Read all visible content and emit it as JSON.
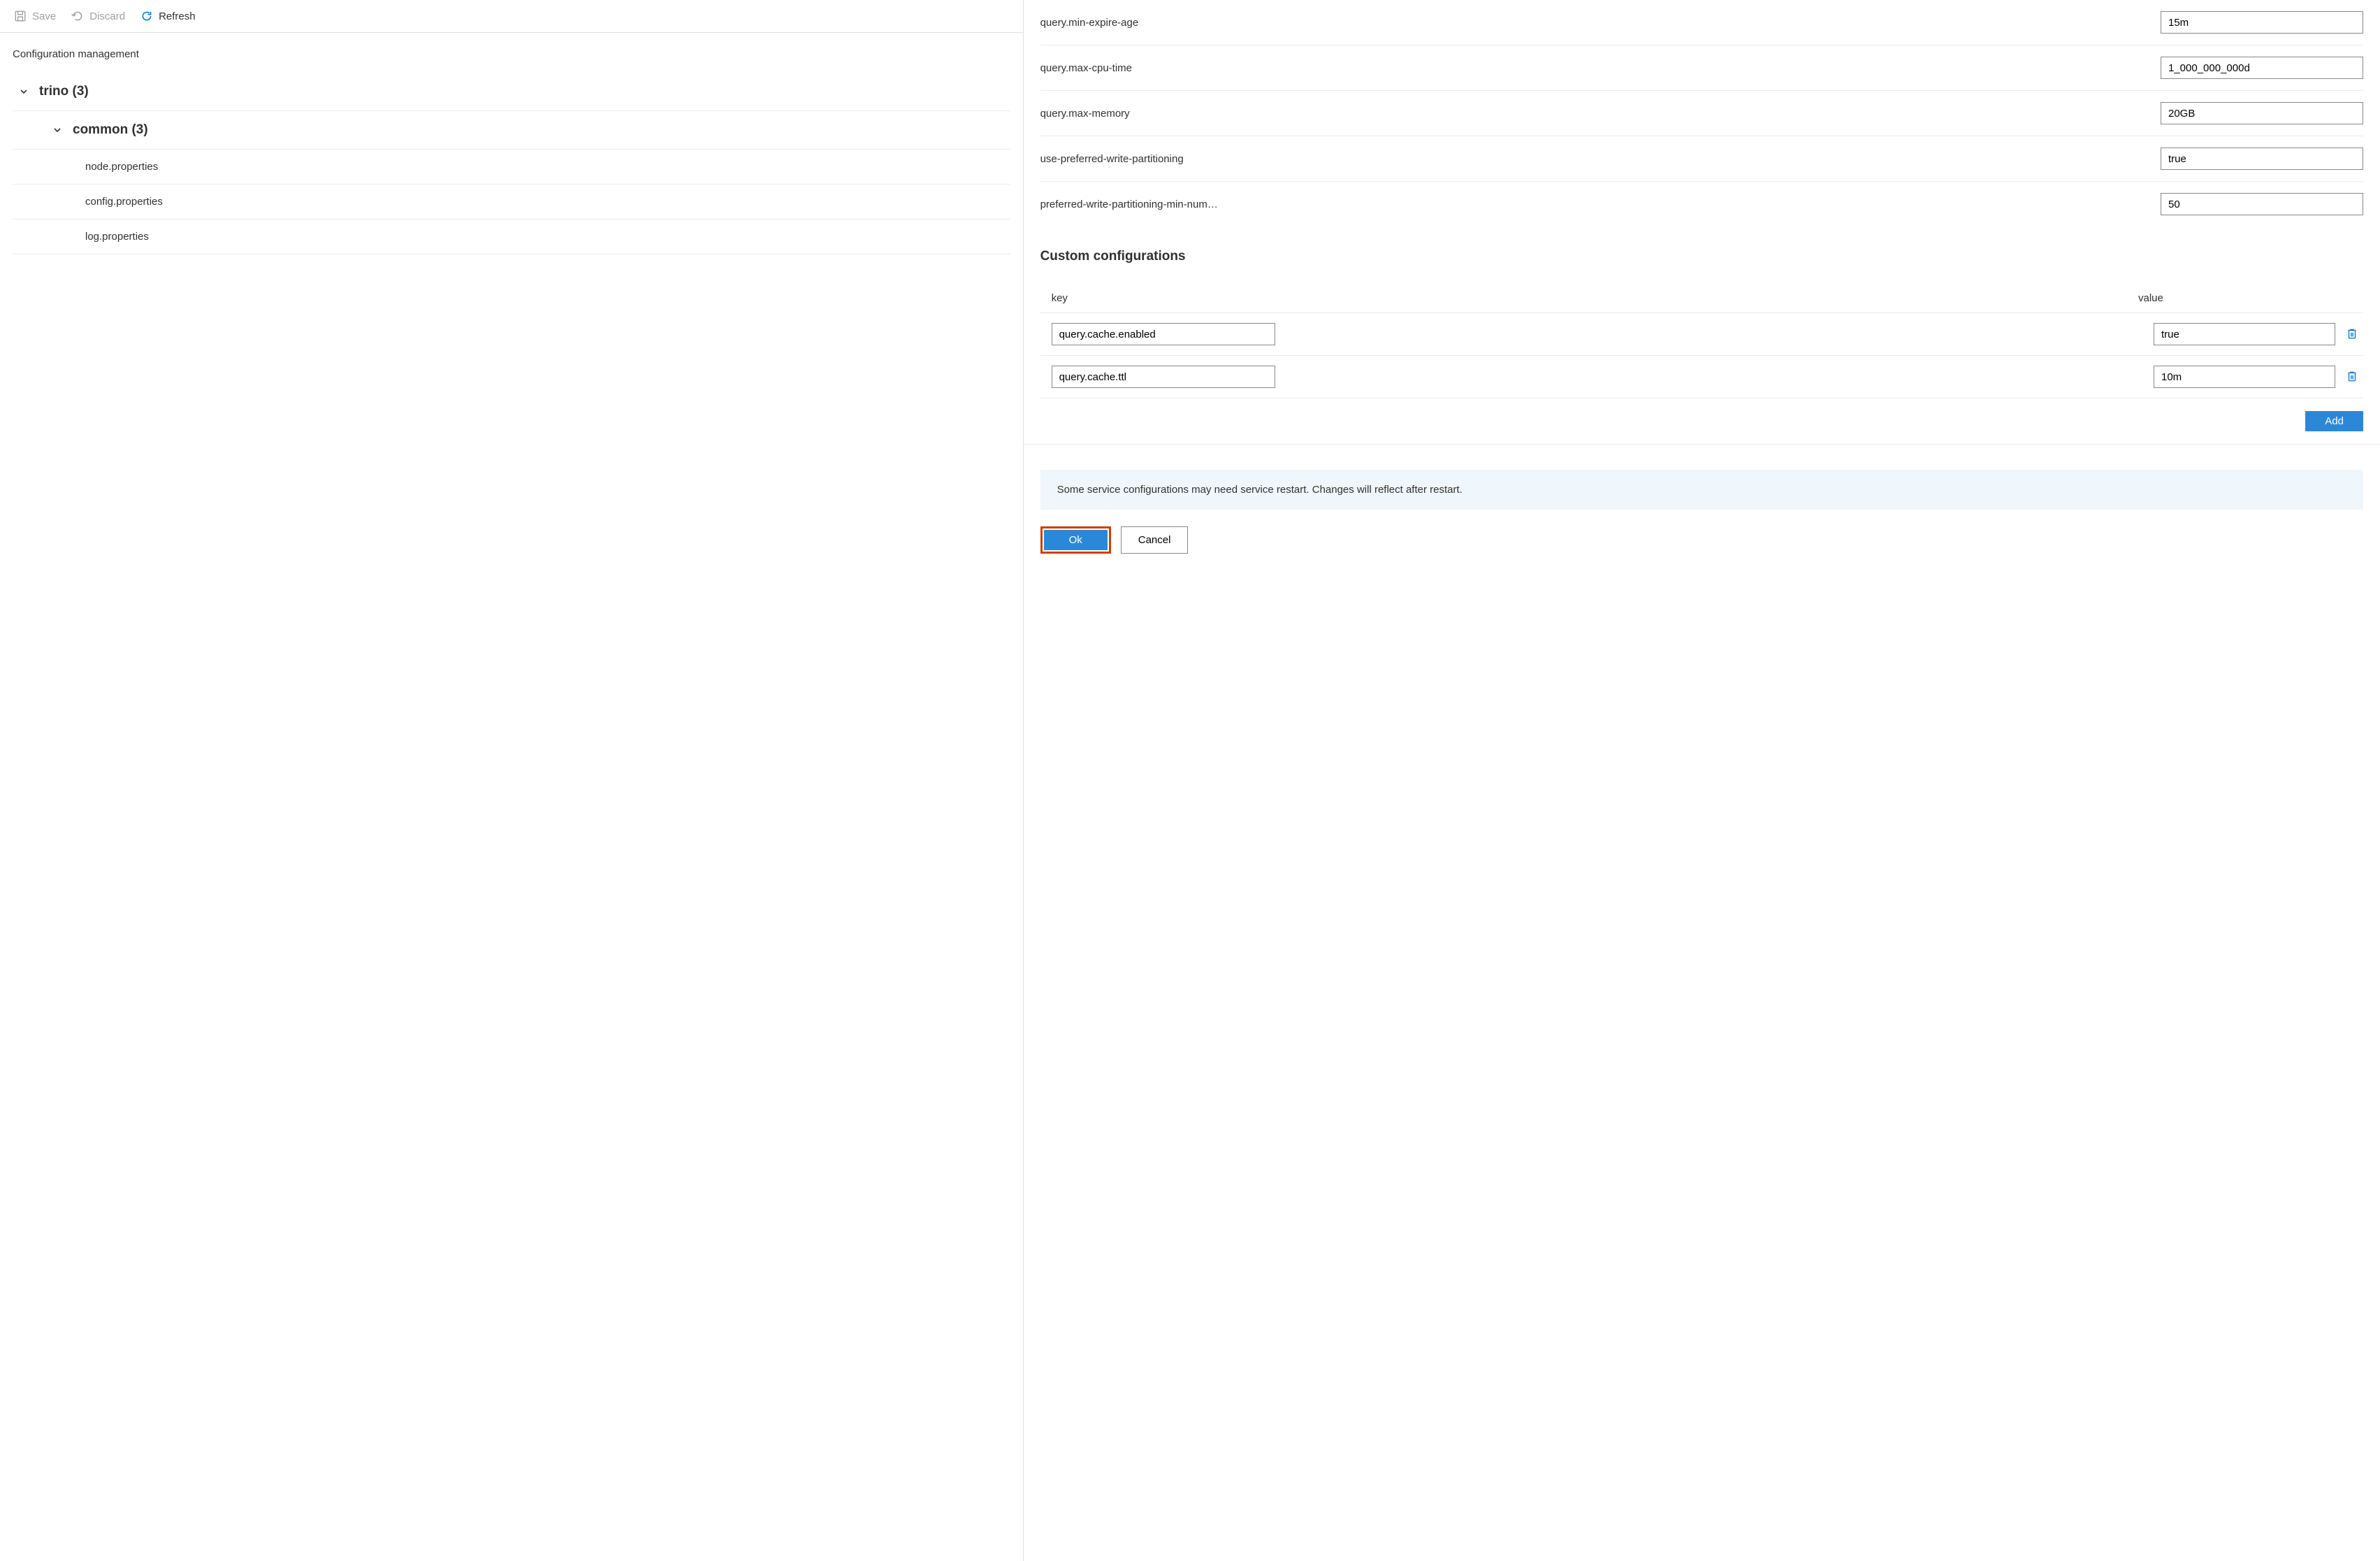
{
  "toolbar": {
    "save_label": "Save",
    "discard_label": "Discard",
    "refresh_label": "Refresh"
  },
  "section_title": "Configuration management",
  "tree": {
    "root": {
      "label": "trino (3)"
    },
    "group": {
      "label": "common (3)"
    },
    "files": [
      {
        "label": "node.properties"
      },
      {
        "label": "config.properties"
      },
      {
        "label": "log.properties"
      }
    ]
  },
  "config_rows": [
    {
      "label": "query.min-expire-age",
      "value": "15m"
    },
    {
      "label": "query.max-cpu-time",
      "value": "1_000_000_000d"
    },
    {
      "label": "query.max-memory",
      "value": "20GB"
    },
    {
      "label": "use-preferred-write-partitioning",
      "value": "true"
    },
    {
      "label": "preferred-write-partitioning-min-num…",
      "value": "50"
    }
  ],
  "custom": {
    "title": "Custom configurations",
    "header_key": "key",
    "header_value": "value",
    "rows": [
      {
        "key": "query.cache.enabled",
        "value": "true"
      },
      {
        "key": "query.cache.ttl",
        "value": "10m"
      }
    ],
    "add_label": "Add"
  },
  "info_banner": "Some service configurations may need service restart. Changes will reflect after restart.",
  "footer": {
    "ok_label": "Ok",
    "cancel_label": "Cancel"
  }
}
